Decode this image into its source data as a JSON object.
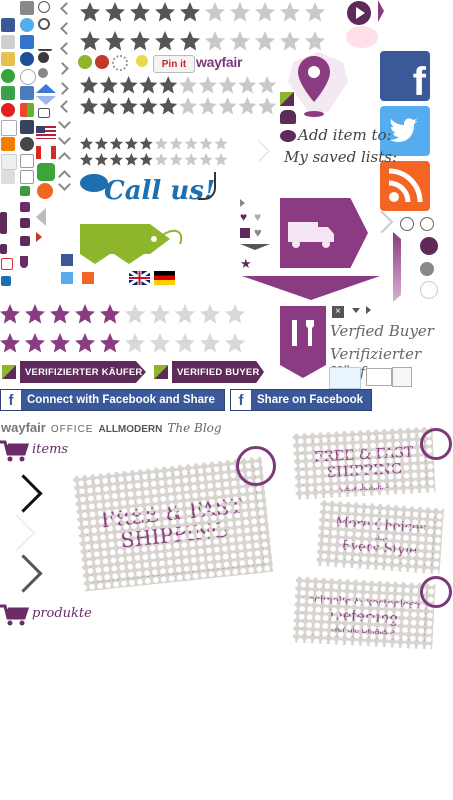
{
  "colors": {
    "purple": "#8a3b82",
    "dark_purple": "#5e2a5a",
    "facebook": "#3b5998",
    "twitter": "#55acee",
    "rss": "#f26522",
    "green": "#8fb52d",
    "wayfair": "#7d3a78",
    "call_blue": "#1d6fb0"
  },
  "buttons": {
    "pinit": "Pin it"
  },
  "brands": {
    "wayfair": "wayfair",
    "office": "OFFICE",
    "allmodern": "ALLMODERN",
    "blog": "The Blog"
  },
  "saved": {
    "line1": "Add item to:",
    "line2": "My saved lists:"
  },
  "call": {
    "text": "Call us!"
  },
  "verified": {
    "buyer_en": "Verfied Buyer",
    "buyer_de": "Verifizierter Käufer"
  },
  "badges": {
    "de": "VERIFIZIERTER KÄUFER",
    "en": "VERIFIED BUYER"
  },
  "facebook": {
    "connect": "Connect with Facebook and Share",
    "share": "Share on Facebook",
    "f": "f"
  },
  "carts": {
    "items": "items",
    "produkte": "produkte"
  },
  "stamps": {
    "big_line1": "FREE & FAST",
    "big_line2": "SHIPPING",
    "small_line1": "FREE & FAST",
    "small_line2": "SHIPPING",
    "small_link": "view details >",
    "more_line1": "More Choices",
    "more_line2": "-on-",
    "more_line3": "Every Style",
    "de_line1": "schnelle & kostenlose",
    "de_line2": "Lieferung",
    "de_link": "hier die Details >"
  },
  "icons": [
    "print-icon",
    "add-icon",
    "facebook-icon",
    "twitter-icon",
    "search-icon",
    "folder-icon",
    "delicious-icon",
    "stumbleupon-icon",
    "google-icon",
    "digg-icon",
    "blogger-icon",
    "tumblr-icon",
    "wordpress-icon",
    "flag-us-icon",
    "flag-uk-icon",
    "flag-de-icon",
    "truck-icon",
    "tag-icon",
    "map-pin-icon",
    "heart-icon",
    "people-icon",
    "tools-icon",
    "smiley-icon",
    "cart-icon",
    "mail-icon",
    "rss-icon",
    "play-icon"
  ]
}
